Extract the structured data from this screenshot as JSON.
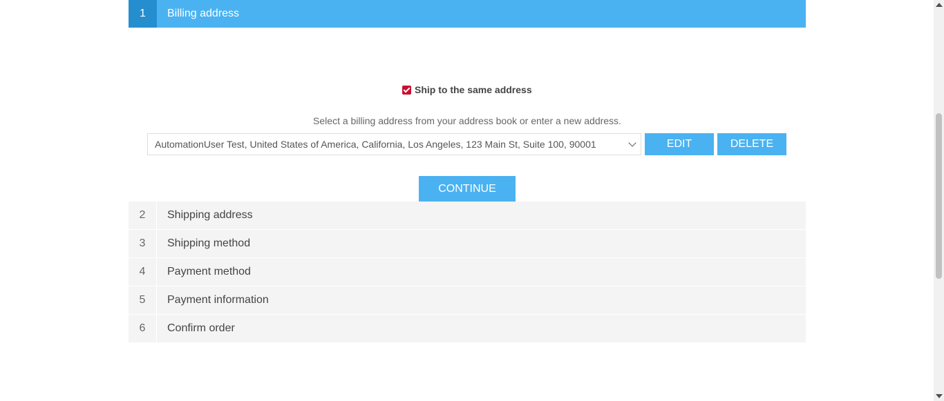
{
  "active_step": {
    "number": "1",
    "title": "Billing address"
  },
  "billing": {
    "ship_same_label": "Ship to the same address",
    "ship_same_checked": true,
    "select_hint": "Select a billing address from your address book or enter a new address.",
    "selected_address": "AutomationUser Test, United States of America, California, Los Angeles, 123 Main St, Suite 100, 90001",
    "edit_label": "EDIT",
    "delete_label": "DELETE",
    "continue_label": "CONTINUE"
  },
  "steps": [
    {
      "number": "2",
      "title": "Shipping address"
    },
    {
      "number": "3",
      "title": "Shipping method"
    },
    {
      "number": "4",
      "title": "Payment method"
    },
    {
      "number": "5",
      "title": "Payment information"
    },
    {
      "number": "6",
      "title": "Confirm order"
    }
  ],
  "colors": {
    "accent": "#4ab2f1",
    "accent_dark": "#248ece",
    "checkbox": "#c8102e"
  }
}
